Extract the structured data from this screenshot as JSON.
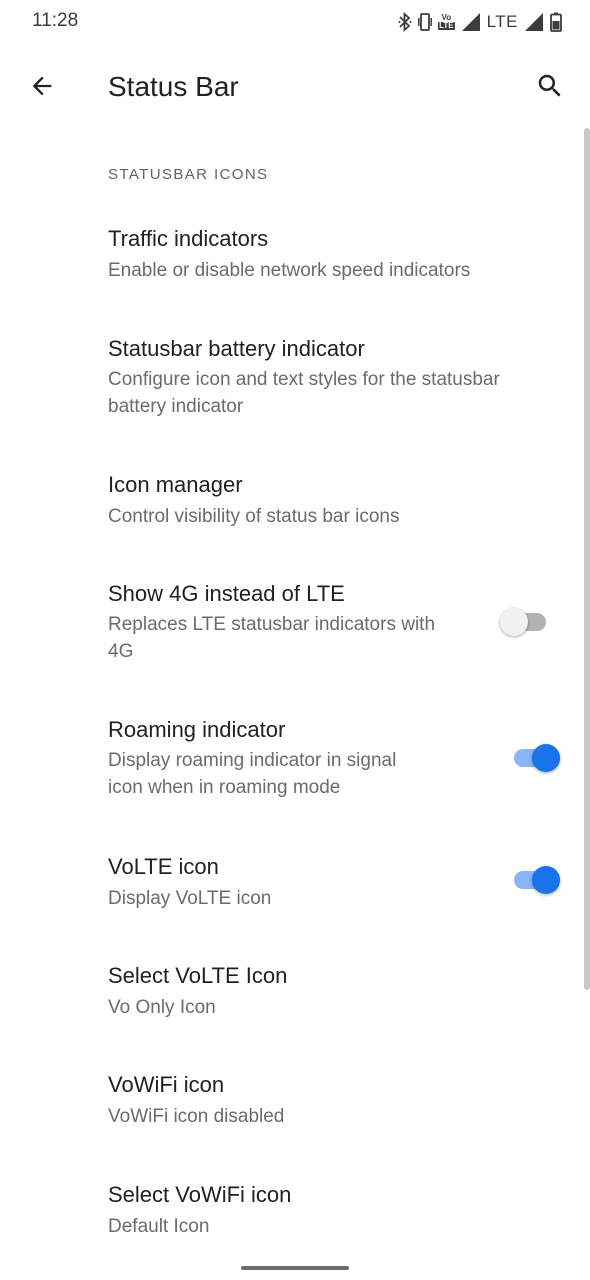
{
  "status_bar": {
    "time": "11:28",
    "volte_top": "Vo",
    "volte_bottom": "LTE",
    "network": "LTE"
  },
  "app_bar": {
    "title": "Status Bar"
  },
  "section": {
    "header": "STATUSBAR ICONS"
  },
  "preferences": [
    {
      "title": "Traffic indicators",
      "summary": "Enable or disable network speed indicators"
    },
    {
      "title": "Statusbar battery indicator",
      "summary_line1": "Configure icon and text styles for the statusbar",
      "summary_line2": "battery indicator"
    },
    {
      "title": "Icon manager",
      "summary": "Control visibility of status bar icons"
    },
    {
      "title": "Show 4G instead of LTE",
      "summary_line1": "Replaces LTE statusbar indicators with",
      "summary_line2": "4G",
      "switch": false
    },
    {
      "title": "Roaming indicator",
      "summary_line1": "Display roaming indicator in signal",
      "summary_line2": "icon when in roaming mode",
      "switch": true
    },
    {
      "title": "VoLTE icon",
      "summary": "Display VoLTE icon",
      "switch": true
    },
    {
      "title": "Select VoLTE Icon",
      "summary": "Vo Only Icon"
    },
    {
      "title": "VoWiFi icon",
      "summary": "VoWiFi icon disabled"
    },
    {
      "title": "Select VoWiFi icon",
      "summary": "Default Icon"
    }
  ],
  "colors": {
    "accent": "#1a73e8",
    "accent_track": "#8ab4f8"
  }
}
